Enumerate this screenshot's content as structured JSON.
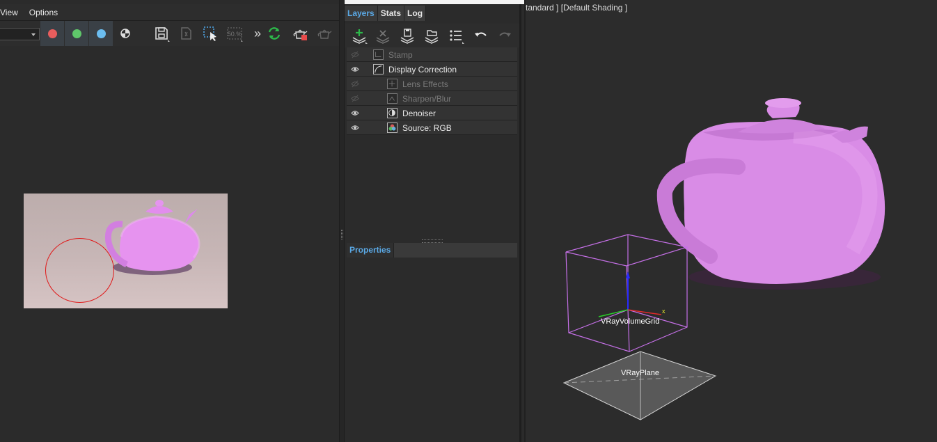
{
  "menubar": {
    "items": [
      "View",
      "Options"
    ]
  },
  "toolbar": {
    "channel_colors": {
      "red": "#e85d5d",
      "green": "#5fc76a",
      "blue": "#6bbdf0"
    },
    "icons": [
      "color-correction-icon",
      "save-icon",
      "clear-icon",
      "region-render-icon",
      "fifty-percent-icon",
      "more-chevron-icon",
      "interactive-render-icon",
      "render-teapot-icon",
      "render-teapot-disabled-icon"
    ],
    "icon_fifty_text": "50.%",
    "chevron_text": "»"
  },
  "tabs": [
    {
      "label": "Layers",
      "active": true
    },
    {
      "label": "Stats",
      "active": false
    },
    {
      "label": "Log",
      "active": false
    }
  ],
  "layer_toolbar_icons": [
    "add-layer-icon",
    "delete-layer-icon",
    "save-layers-icon",
    "load-layers-icon",
    "list-icon",
    "undo-icon",
    "redo-icon"
  ],
  "layers": [
    {
      "name": "Stamp",
      "visible": false,
      "thumb": "stamp",
      "indent": 0
    },
    {
      "name": "Display Correction",
      "visible": true,
      "thumb": "curve",
      "indent": 0
    },
    {
      "name": "Lens Effects",
      "visible": false,
      "thumb": "lens",
      "indent": 1
    },
    {
      "name": "Sharpen/Blur",
      "visible": false,
      "thumb": "sharpen",
      "indent": 1
    },
    {
      "name": "Denoiser",
      "visible": true,
      "thumb": "denoise",
      "indent": 1
    },
    {
      "name": "Source: RGB",
      "visible": true,
      "thumb": "rgb",
      "indent": 1
    }
  ],
  "properties": {
    "title": "Properties"
  },
  "viewport": {
    "label": "tandard ] [Default Shading ]",
    "objects": {
      "volume_grid": "VRayVolumeGrid",
      "plane": "VRayPlane"
    },
    "gizmo_axis_x": "x",
    "teapot_color": "#d98ce6"
  }
}
